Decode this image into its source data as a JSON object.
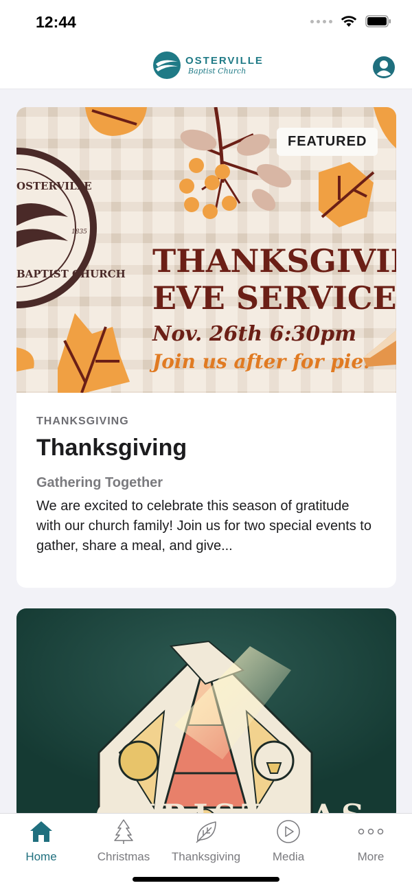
{
  "status_bar": {
    "time": "12:44"
  },
  "header": {
    "logo_name": "OSTERVILLE",
    "logo_sub": "Baptist Church",
    "brand_color": "#1f7a86"
  },
  "featured_card": {
    "badge": "FEATURED",
    "banner": {
      "headline_line1": "THANKSGIVING",
      "headline_line2": "EVE SERVICE",
      "date_line": "Nov. 26th 6:30pm",
      "tagline": "Join us after for pie!",
      "seal_top": "OSTERVILLE",
      "seal_bottom": "BAPTIST CHURCH",
      "seal_year": "1835"
    },
    "category": "THANKSGIVING",
    "title": "Thanksgiving",
    "subtitle": "Gathering Together",
    "description": "We are excited to celebrate this season of gratitude with our church family! Join us for two special events to gather, share a meal, and give..."
  },
  "second_card": {
    "banner": {
      "headline_partial": "CHRISTMAS"
    }
  },
  "tab_bar": {
    "active_color": "#1f6f7e",
    "tabs": [
      {
        "label": "Home",
        "icon": "home-icon",
        "active": true
      },
      {
        "label": "Christmas",
        "icon": "tree-icon",
        "active": false
      },
      {
        "label": "Thanksgiving",
        "icon": "leaf-icon",
        "active": false
      },
      {
        "label": "Media",
        "icon": "play-circle-icon",
        "active": false
      },
      {
        "label": "More",
        "icon": "more-dots-icon",
        "active": false
      }
    ]
  }
}
